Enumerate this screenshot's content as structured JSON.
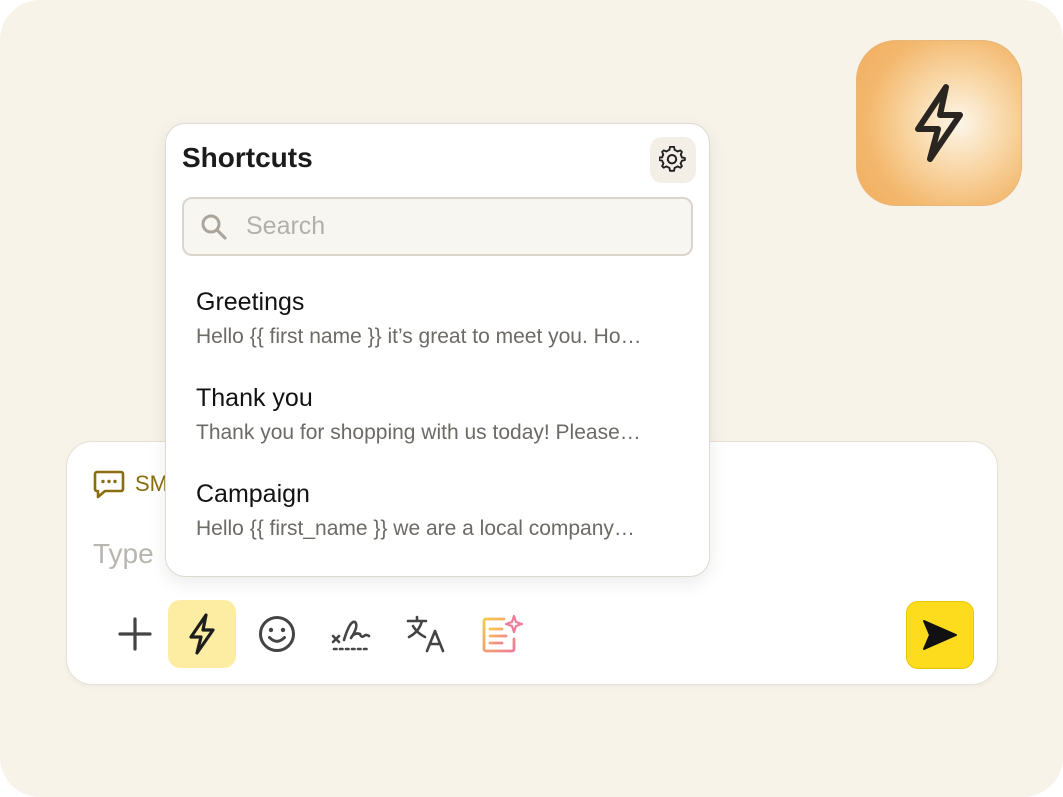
{
  "colors": {
    "background": "#f8f3e9",
    "accent_yellow": "#fddc1e",
    "active_tool": "#fdeda2",
    "channel_color": "#8a6d0e",
    "app_icon_orange": "#f3b86e"
  },
  "app_icon": {
    "icon": "lightning-bolt-icon"
  },
  "shortcuts": {
    "title": "Shortcuts",
    "settings_icon": "gear-icon",
    "search": {
      "placeholder": "Search",
      "value": ""
    },
    "items": [
      {
        "title": "Greetings",
        "preview": "Hello {{ first name }} it’s great to meet you. Ho…"
      },
      {
        "title": "Thank you",
        "preview": "Thank you for shopping with us today! Please…"
      },
      {
        "title": "Campaign",
        "preview": "Hello {{ first_name }} we are a local company…"
      }
    ]
  },
  "composer": {
    "channel_label": "SMS",
    "channel_icon": "message-icon",
    "placeholder": "Type",
    "tools": [
      {
        "name": "add",
        "icon": "plus-icon",
        "active": false
      },
      {
        "name": "shortcuts",
        "icon": "lightning-bolt-icon",
        "active": true
      },
      {
        "name": "emoji",
        "icon": "emoji-icon",
        "active": false
      },
      {
        "name": "signature",
        "icon": "signature-icon",
        "active": false
      },
      {
        "name": "translate",
        "icon": "translate-icon",
        "active": false
      },
      {
        "name": "ai-compose",
        "icon": "ai-sparkle-icon",
        "active": false
      }
    ],
    "send_icon": "send-icon"
  }
}
